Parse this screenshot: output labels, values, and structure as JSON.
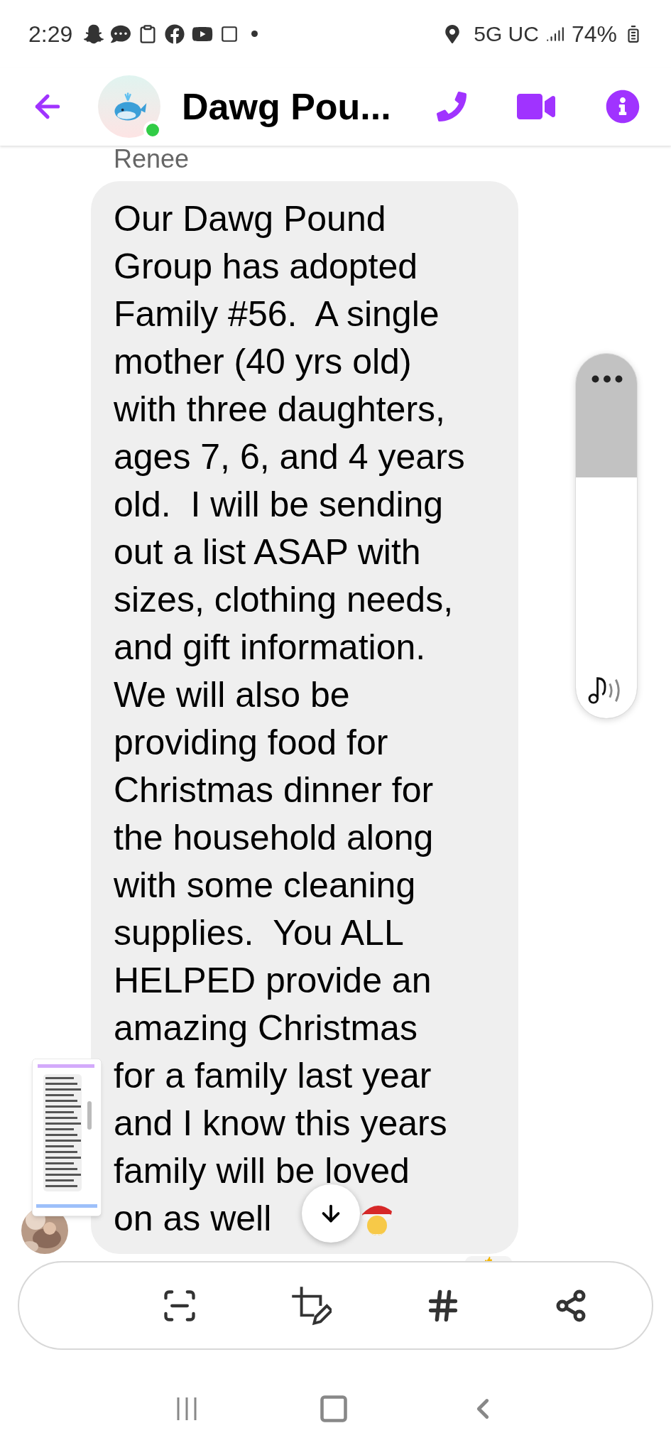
{
  "status_bar": {
    "time": "2:29",
    "network": "5G UC",
    "battery": "74%"
  },
  "header": {
    "title": "Dawg Pou...",
    "online": true
  },
  "message": {
    "sender": "Renee",
    "lines": [
      "Our Dawg Pound",
      "Group has adopted",
      "Family #56.  A single",
      "mother (40 yrs old)",
      "with three daughters,",
      "ages 7, 6, and 4 years",
      "old.  I will be sending",
      "out a list ASAP with",
      "sizes, clothing needs,",
      "and gift information.",
      "We will also be",
      "providing food for",
      "Christmas dinner for",
      "the household along",
      "with some cleaning",
      "supplies.  You ALL",
      "HELPED provide an",
      "amazing Christmas",
      "for a family last year",
      "and I know this years",
      "family will be loved",
      "on as well"
    ]
  },
  "volume_slider": {
    "level": 0.66
  }
}
